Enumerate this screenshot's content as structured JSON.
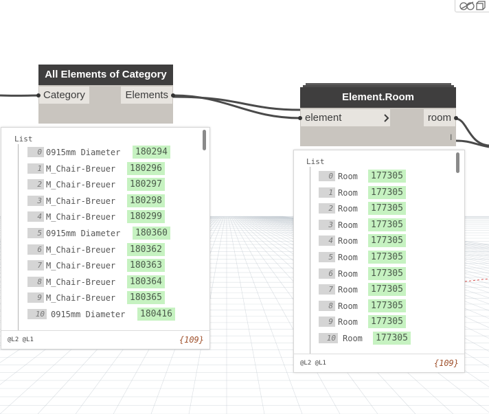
{
  "nodes": {
    "all_elements": {
      "title": "All Elements of Category",
      "input": "Category",
      "output": "Elements"
    },
    "element_room": {
      "title": "Element.Room",
      "input": "element",
      "output": "room",
      "lacing": "l"
    }
  },
  "preview_left": {
    "list_label": "List",
    "items": [
      {
        "index": "0",
        "name": "0915mm Diameter",
        "value": "180294"
      },
      {
        "index": "1",
        "name": "M_Chair-Breuer",
        "value": "180296"
      },
      {
        "index": "2",
        "name": "M_Chair-Breuer",
        "value": "180297"
      },
      {
        "index": "3",
        "name": "M_Chair-Breuer",
        "value": "180298"
      },
      {
        "index": "4",
        "name": "M_Chair-Breuer",
        "value": "180299"
      },
      {
        "index": "5",
        "name": "0915mm Diameter",
        "value": "180360"
      },
      {
        "index": "6",
        "name": "M_Chair-Breuer",
        "value": "180362"
      },
      {
        "index": "7",
        "name": "M_Chair-Breuer",
        "value": "180363"
      },
      {
        "index": "8",
        "name": "M_Chair-Breuer",
        "value": "180364"
      },
      {
        "index": "9",
        "name": "M_Chair-Breuer",
        "value": "180365"
      },
      {
        "index": "10",
        "name": "0915mm Diameter",
        "value": "180416"
      }
    ],
    "levels": "@L2 @L1",
    "count": "{109}"
  },
  "preview_right": {
    "list_label": "List",
    "items": [
      {
        "index": "0",
        "name": "Room",
        "value": "177305"
      },
      {
        "index": "1",
        "name": "Room",
        "value": "177305"
      },
      {
        "index": "2",
        "name": "Room",
        "value": "177305"
      },
      {
        "index": "3",
        "name": "Room",
        "value": "177305"
      },
      {
        "index": "4",
        "name": "Room",
        "value": "177305"
      },
      {
        "index": "5",
        "name": "Room",
        "value": "177305"
      },
      {
        "index": "6",
        "name": "Room",
        "value": "177305"
      },
      {
        "index": "7",
        "name": "Room",
        "value": "177305"
      },
      {
        "index": "8",
        "name": "Room",
        "value": "177305"
      },
      {
        "index": "9",
        "name": "Room",
        "value": "177305"
      },
      {
        "index": "10",
        "name": "Room",
        "value": "177305"
      }
    ],
    "levels": "@L2 @L1",
    "count": "{109}"
  },
  "colors": {
    "node_header": "#3f3e3e",
    "node_body": "#c9c5bf",
    "port": "#e7e4df",
    "value_highlight": "#c6f2c1",
    "wire": "#4a4a4a",
    "grid": "#b9c2ca"
  },
  "icons": [
    "background-preview-icon",
    "zoom-extents-icon",
    "chevron-right-icon"
  ]
}
